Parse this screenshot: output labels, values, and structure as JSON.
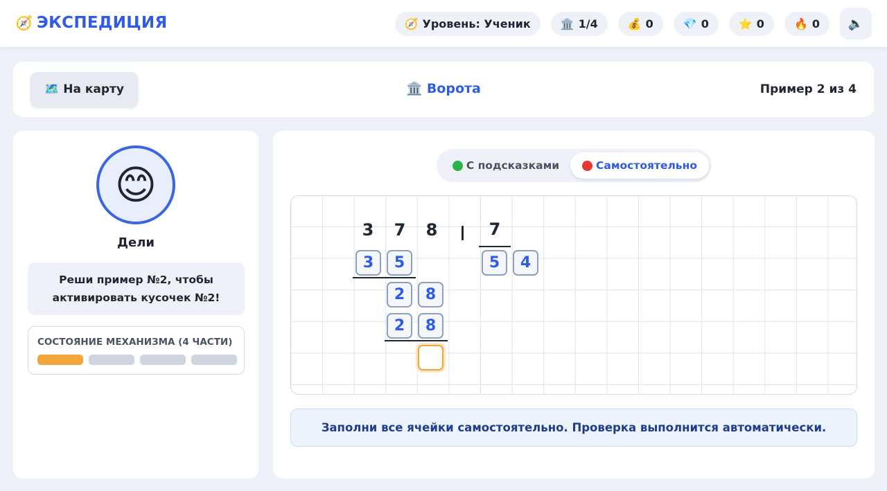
{
  "app": {
    "brand_icon": "🧭",
    "brand_name": "ЭКСПЕДИЦИЯ"
  },
  "stats": {
    "level": {
      "icon": "🧭",
      "text": "Уровень: Ученик"
    },
    "gates": {
      "icon": "🏛️",
      "value": "1/4"
    },
    "coins": {
      "icon": "💰",
      "value": "0"
    },
    "gems": {
      "icon": "💎",
      "value": "0"
    },
    "stars": {
      "icon": "⭐",
      "value": "0"
    },
    "fire": {
      "icon": "🔥",
      "value": "0"
    },
    "sound_icon": "🔈"
  },
  "header": {
    "map_button": {
      "icon": "🗺️",
      "label": "На карту"
    },
    "title": {
      "icon": "🏛️",
      "text": "Ворота"
    },
    "progress": "Пример 2 из 4"
  },
  "character": {
    "avatar": "😊",
    "name": "Дели",
    "message": "Реши пример №2, чтобы активировать кусочек №2!"
  },
  "mechanism": {
    "title": "СОСТОЯНИЕ МЕХАНИЗМА (4 ЧАСТИ)",
    "total_parts": 4,
    "active_parts": 1
  },
  "modes": {
    "hints": {
      "label": "С подсказками",
      "color": "#2bb34a"
    },
    "solo": {
      "label": "Самостоятельно",
      "color": "#e53935"
    },
    "selected": "solo"
  },
  "division": {
    "dividend": [
      "3",
      "7",
      "8"
    ],
    "divisor": "7",
    "quotient": [
      "5",
      "4"
    ],
    "step1_subtract": [
      "3",
      "5"
    ],
    "step2_remainder": [
      "2",
      "8"
    ],
    "step2_subtract": [
      "2",
      "8"
    ],
    "final_cell": ""
  },
  "hint": "Заполни все ячейки самостоятельно. Проверка выполнится автоматически.",
  "colors": {
    "accent": "#2e5ce6",
    "active_cell": "#f0a63a",
    "mechanism_on": "#f0a63a",
    "mechanism_off": "#cfd5df"
  }
}
